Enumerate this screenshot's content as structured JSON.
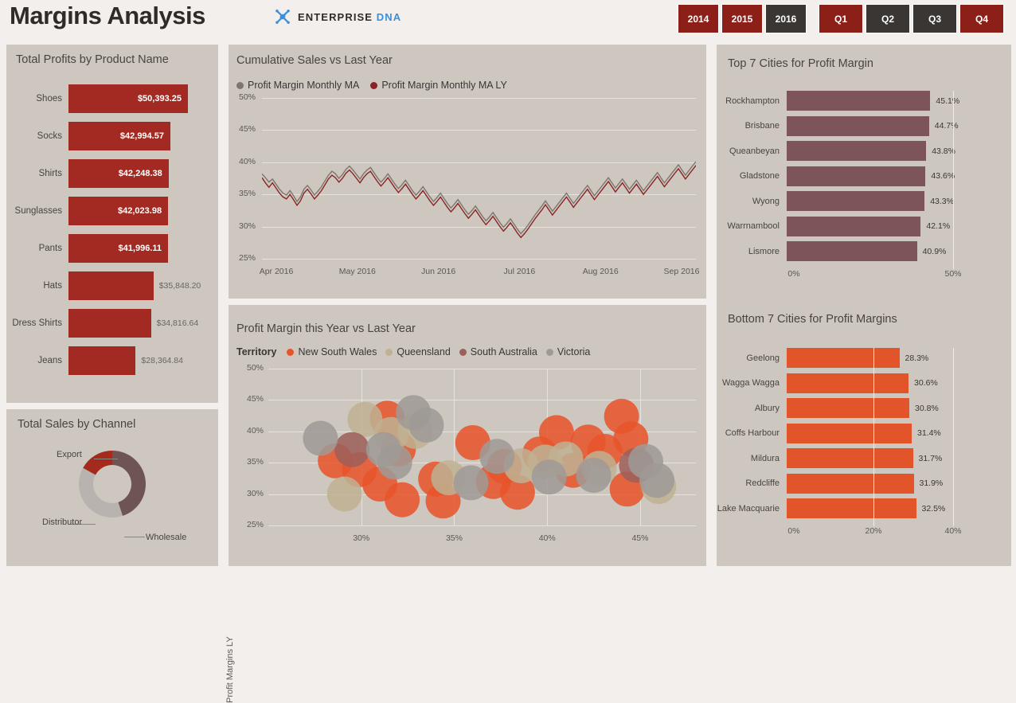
{
  "header": {
    "title": "Margins Analysis",
    "brand": {
      "part1": "ENTERPRISE",
      "part2": "DNA",
      "mark_icon": "dna-helix-icon"
    },
    "year_slicer": [
      {
        "label": "2014",
        "selected": false
      },
      {
        "label": "2015",
        "selected": false
      },
      {
        "label": "2016",
        "selected": true
      }
    ],
    "quarter_slicer": [
      {
        "label": "Q1",
        "selected": false
      },
      {
        "label": "Q2",
        "selected": true
      },
      {
        "label": "Q3",
        "selected": true
      },
      {
        "label": "Q4",
        "selected": false
      }
    ]
  },
  "colors": {
    "page_bg": "#f2efec",
    "panel_bg": "#cdc7c0",
    "brick_red": "#a32a22",
    "slicer_red": "#8c2018",
    "slicer_dark": "#3a3634",
    "mauve": "#7d5457",
    "orange": "#e2552a",
    "line_gray": "#7d766e",
    "line_darkred": "#8b2323",
    "donut_wholesale": "#6e5452",
    "donut_distributor": "#b8b3ae",
    "donut_export": "#a52a1e",
    "bubble_nsw": "#e8542a",
    "bubble_qld": "#bfb193",
    "bubble_sa": "#9d5f5a",
    "bubble_vic": "#9e9a96"
  },
  "panels": {
    "products_title": "Total Profits by Product Name",
    "channel_title": "Total Sales by Channel",
    "cumsales_title": "Cumulative Sales vs Last Year",
    "scatter_title": "Profit Margin this Year vs Last Year",
    "top_cities_title": "Top 7 Cities for Profit Margin",
    "bottom_cities_title": "Bottom 7 Cities for Profit Margins"
  },
  "chart_data": [
    {
      "type": "bar",
      "title": "Total Profits by Product Name",
      "orientation": "horizontal",
      "xlabel": "",
      "ylabel": "",
      "categories": [
        "Shoes",
        "Socks",
        "Shirts",
        "Sunglasses",
        "Pants",
        "Hats",
        "Dress Shirts",
        "Jeans"
      ],
      "values": [
        50393.25,
        42994.57,
        42248.38,
        42023.98,
        41996.11,
        35848.2,
        34816.64,
        28364.84
      ],
      "labels": [
        "$50,393.25",
        "$42,994.57",
        "$42,248.38",
        "$42,023.98",
        "$41,996.11",
        "$35,848.20",
        "$34,816.64",
        "$28,364.84"
      ],
      "label_inside": [
        true,
        true,
        true,
        true,
        true,
        false,
        false,
        false
      ],
      "color": "#a32a22",
      "grid": false
    },
    {
      "type": "pie",
      "title": "Total Sales by Channel",
      "donut": true,
      "categories": [
        "Wholesale",
        "Distributor",
        "Export"
      ],
      "values": [
        45,
        38,
        17
      ],
      "colors": [
        "#6e5452",
        "#b8b3ae",
        "#a52a1e"
      ],
      "legend": "labels-with-leader-lines"
    },
    {
      "type": "line",
      "title": "Cumulative Sales vs Last Year",
      "xlabel": "",
      "ylabel": "",
      "ylim": [
        25,
        50
      ],
      "yticks": [
        "25%",
        "30%",
        "35%",
        "40%",
        "45%",
        "50%"
      ],
      "xticks": [
        "Apr 2016",
        "May 2016",
        "Jun 2016",
        "Jul 2016",
        "Aug 2016",
        "Sep 2016"
      ],
      "grid": true,
      "legend_position": "top-left",
      "series": [
        {
          "name": "Profit Margin Monthly MA",
          "color": "#7d766e",
          "values": [
            38.2,
            37.6,
            36.9,
            37.4,
            36.6,
            35.8,
            35.2,
            34.9,
            35.6,
            34.8,
            33.9,
            34.6,
            35.8,
            36.4,
            35.7,
            34.9,
            35.5,
            36.2,
            37.1,
            38.0,
            38.6,
            38.2,
            37.5,
            38.1,
            38.9,
            39.4,
            38.8,
            38.1,
            37.4,
            38.2,
            38.8,
            39.2,
            38.4,
            37.6,
            36.9,
            37.5,
            38.2,
            37.4,
            36.6,
            35.9,
            36.5,
            37.2,
            36.4,
            35.6,
            34.9,
            35.5,
            36.2,
            35.4,
            34.6,
            33.9,
            34.5,
            35.2,
            34.4,
            33.6,
            32.9,
            33.5,
            34.2,
            33.4,
            32.6,
            31.9,
            32.5,
            33.2,
            32.4,
            31.6,
            30.9,
            31.5,
            32.2,
            31.4,
            30.6,
            29.9,
            30.5,
            31.2,
            30.4,
            29.6,
            28.9,
            29.5,
            30.2,
            31.0,
            31.8,
            32.5,
            33.2,
            34.0,
            33.2,
            32.4,
            33.1,
            33.8,
            34.5,
            35.2,
            34.4,
            33.6,
            34.3,
            35.0,
            35.7,
            36.4,
            35.6,
            34.8,
            35.5,
            36.2,
            36.9,
            37.6,
            36.8,
            36.0,
            36.7,
            37.4,
            36.6,
            35.8,
            36.5,
            37.2,
            36.4,
            35.6,
            36.3,
            37.0,
            37.7,
            38.4,
            37.6,
            36.8,
            37.5,
            38.2,
            38.9,
            39.6,
            38.8,
            38.0,
            38.7,
            39.4,
            40.1
          ]
        },
        {
          "name": "Profit Margin Monthly MA LY",
          "color": "#8b2323",
          "values": [
            37.6,
            36.8,
            36.1,
            36.8,
            36.0,
            35.2,
            34.6,
            34.3,
            35.0,
            34.2,
            33.3,
            34.0,
            35.2,
            35.8,
            35.1,
            34.3,
            34.9,
            35.6,
            36.5,
            37.4,
            38.0,
            37.6,
            36.9,
            37.5,
            38.3,
            38.8,
            38.2,
            37.5,
            36.8,
            37.6,
            38.2,
            38.6,
            37.8,
            37.0,
            36.3,
            36.9,
            37.6,
            36.8,
            36.0,
            35.3,
            35.9,
            36.6,
            35.8,
            35.0,
            34.3,
            34.9,
            35.6,
            34.8,
            34.0,
            33.3,
            33.9,
            34.6,
            33.8,
            33.0,
            32.3,
            32.9,
            33.6,
            32.8,
            32.0,
            31.3,
            31.9,
            32.6,
            31.8,
            31.0,
            30.3,
            30.9,
            31.6,
            30.8,
            30.0,
            29.3,
            29.9,
            30.6,
            29.8,
            29.0,
            28.3,
            28.9,
            29.6,
            30.4,
            31.2,
            31.9,
            32.6,
            33.4,
            32.6,
            31.8,
            32.5,
            33.2,
            33.9,
            34.6,
            33.8,
            33.0,
            33.7,
            34.4,
            35.1,
            35.8,
            35.0,
            34.2,
            34.9,
            35.6,
            36.3,
            37.0,
            36.2,
            35.4,
            36.1,
            36.8,
            36.0,
            35.2,
            35.9,
            36.6,
            35.8,
            35.0,
            35.7,
            36.4,
            37.1,
            37.8,
            37.0,
            36.2,
            36.9,
            37.6,
            38.3,
            39.0,
            38.2,
            37.4,
            38.1,
            38.8,
            39.5
          ]
        }
      ]
    },
    {
      "type": "scatter",
      "title": "Profit Margin this Year vs Last Year",
      "xlabel": "",
      "ylabel": "Profit Margins LY",
      "legend_title": "Territory",
      "xlim": [
        25,
        48
      ],
      "ylim": [
        25,
        50
      ],
      "xticks": [
        "30%",
        "35%",
        "40%",
        "45%"
      ],
      "yticks": [
        "25%",
        "30%",
        "35%",
        "40%",
        "45%",
        "50%"
      ],
      "grid": true,
      "series": [
        {
          "name": "New South Wales",
          "color": "#e8542a"
        },
        {
          "name": "Queensland",
          "color": "#bfb193"
        },
        {
          "name": "South Australia",
          "color": "#9d5f5a"
        },
        {
          "name": "Victoria",
          "color": "#9e9a96"
        }
      ],
      "points": [
        {
          "x": 28.6,
          "y": 35.3,
          "s": "New South Wales"
        },
        {
          "x": 29.9,
          "y": 33.9,
          "s": "New South Wales"
        },
        {
          "x": 31.4,
          "y": 42.1,
          "s": "New South Wales"
        },
        {
          "x": 32.0,
          "y": 37.2,
          "s": "New South Wales"
        },
        {
          "x": 31.0,
          "y": 31.6,
          "s": "New South Wales"
        },
        {
          "x": 32.2,
          "y": 29.1,
          "s": "New South Wales"
        },
        {
          "x": 34.0,
          "y": 32.4,
          "s": "New South Wales"
        },
        {
          "x": 34.4,
          "y": 28.9,
          "s": "New South Wales"
        },
        {
          "x": 36.0,
          "y": 38.2,
          "s": "New South Wales"
        },
        {
          "x": 37.1,
          "y": 32.0,
          "s": "New South Wales"
        },
        {
          "x": 37.7,
          "y": 34.4,
          "s": "New South Wales"
        },
        {
          "x": 38.4,
          "y": 30.3,
          "s": "New South Wales"
        },
        {
          "x": 39.6,
          "y": 36.4,
          "s": "New South Wales"
        },
        {
          "x": 40.5,
          "y": 39.8,
          "s": "New South Wales"
        },
        {
          "x": 41.4,
          "y": 33.8,
          "s": "New South Wales"
        },
        {
          "x": 42.2,
          "y": 38.3,
          "s": "New South Wales"
        },
        {
          "x": 43.1,
          "y": 36.8,
          "s": "New South Wales"
        },
        {
          "x": 44.0,
          "y": 42.4,
          "s": "New South Wales"
        },
        {
          "x": 44.5,
          "y": 38.8,
          "s": "New South Wales"
        },
        {
          "x": 44.3,
          "y": 30.8,
          "s": "New South Wales"
        },
        {
          "x": 30.2,
          "y": 41.9,
          "s": "Queensland"
        },
        {
          "x": 31.6,
          "y": 39.5,
          "s": "Queensland"
        },
        {
          "x": 32.9,
          "y": 40.0,
          "s": "Queensland"
        },
        {
          "x": 29.1,
          "y": 30.0,
          "s": "Queensland"
        },
        {
          "x": 34.7,
          "y": 32.6,
          "s": "Queensland"
        },
        {
          "x": 38.6,
          "y": 34.5,
          "s": "Queensland"
        },
        {
          "x": 39.9,
          "y": 35.1,
          "s": "Queensland"
        },
        {
          "x": 41.0,
          "y": 35.6,
          "s": "Queensland"
        },
        {
          "x": 42.8,
          "y": 34.1,
          "s": "Queensland"
        },
        {
          "x": 46.0,
          "y": 31.2,
          "s": "Queensland"
        },
        {
          "x": 29.5,
          "y": 37.1,
          "s": "South Australia"
        },
        {
          "x": 44.8,
          "y": 34.6,
          "s": "South Australia"
        },
        {
          "x": 27.8,
          "y": 38.9,
          "s": "Victoria"
        },
        {
          "x": 31.2,
          "y": 37.1,
          "s": "Victoria"
        },
        {
          "x": 31.8,
          "y": 35.1,
          "s": "Victoria"
        },
        {
          "x": 32.8,
          "y": 43.0,
          "s": "Victoria"
        },
        {
          "x": 33.5,
          "y": 41.0,
          "s": "Victoria"
        },
        {
          "x": 35.9,
          "y": 31.8,
          "s": "Victoria"
        },
        {
          "x": 37.3,
          "y": 36.0,
          "s": "Victoria"
        },
        {
          "x": 40.1,
          "y": 32.7,
          "s": "Victoria"
        },
        {
          "x": 42.5,
          "y": 33.0,
          "s": "Victoria"
        },
        {
          "x": 45.3,
          "y": 35.2,
          "s": "Victoria"
        },
        {
          "x": 45.9,
          "y": 32.2,
          "s": "Victoria"
        }
      ]
    },
    {
      "type": "bar",
      "title": "Top 7 Cities for Profit Margin",
      "orientation": "horizontal",
      "color": "#7d5457",
      "xlim": [
        0,
        50
      ],
      "xticks": [
        "0%",
        "50%"
      ],
      "categories": [
        "Rockhampton",
        "Brisbane",
        "Queanbeyan",
        "Gladstone",
        "Wyong",
        "Warrnambool",
        "Lismore"
      ],
      "values": [
        45.1,
        44.7,
        43.8,
        43.6,
        43.3,
        42.1,
        40.9
      ],
      "labels": [
        "45.1%",
        "44.7%",
        "43.8%",
        "43.6%",
        "43.3%",
        "42.1%",
        "40.9%"
      ]
    },
    {
      "type": "bar",
      "title": "Bottom 7 Cities for Profit Margins",
      "orientation": "horizontal",
      "color": "#e2552a",
      "xlim": [
        0,
        40
      ],
      "xticks": [
        "0%",
        "20%",
        "40%"
      ],
      "categories": [
        "Geelong",
        "Wagga Wagga",
        "Albury",
        "Coffs Harbour",
        "Mildura",
        "Redcliffe",
        "Lake Macquarie"
      ],
      "values": [
        28.3,
        30.6,
        30.8,
        31.4,
        31.7,
        31.9,
        32.5
      ],
      "labels": [
        "28.3%",
        "30.6%",
        "30.8%",
        "31.4%",
        "31.7%",
        "31.9%",
        "32.5%"
      ]
    }
  ]
}
